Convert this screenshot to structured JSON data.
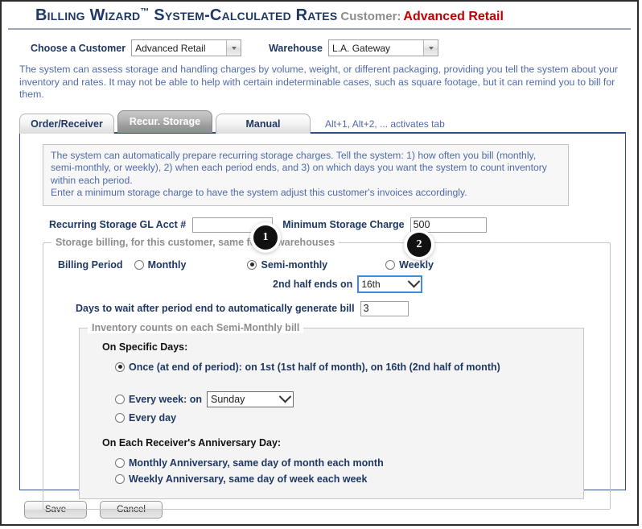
{
  "header": {
    "title_main": "Billing Wizard",
    "title_tm": "™",
    "title_rest": " System-Calculated Rates",
    "customer_label": "Customer:",
    "customer_value": "Advanced Retail"
  },
  "selectors": {
    "customer_label": "Choose a Customer",
    "customer_value": "Advanced Retail",
    "warehouse_label": "Warehouse",
    "warehouse_value": "L.A. Gateway"
  },
  "intro": "The system can assess storage and handling charges by volume, weight, or different packaging, providing you tell the system about your inventory and rates. It may not be able to help with certain indeterminable cases, such as square footage, but it can remind you to bill for them.",
  "tabs": [
    {
      "label": "Order/Receiver",
      "active": false
    },
    {
      "label": "Recur. Storage",
      "active": true
    },
    {
      "label": "Manual",
      "active": false
    }
  ],
  "tab_hint": "Alt+1, Alt+2, ... activates tab",
  "infobox": {
    "line1": "The system can automatically prepare recurring storage charges. Tell the system: 1) how often you bill (monthly, semi-monthly, or weekly), 2) when each period ends, and 3) on which days you want the system to count inventory within each period.",
    "line2": "Enter a minimum storage charge to have the system adjust this customer's invoices accordingly."
  },
  "gl_row": {
    "gl_label": "Recurring Storage GL Acct #",
    "gl_value": "",
    "min_label": "Minimum Storage Charge",
    "min_value": "500"
  },
  "storage_fieldset": {
    "legend": "Storage billing, for this customer, same for all warehouses",
    "billing_period_label": "Billing Period",
    "options": [
      {
        "label": "Monthly",
        "checked": false
      },
      {
        "label": "Semi-monthly",
        "checked": true
      },
      {
        "label": "Weekly",
        "checked": false
      }
    ],
    "second_half_label": "2nd half ends on",
    "second_half_value": "16th",
    "days_label": "Days to wait after period end to automatically generate bill",
    "days_value": "3"
  },
  "inventory_fieldset": {
    "legend": "Inventory counts on each Semi-Monthly bill",
    "specific_days_head": "On Specific Days:",
    "once_option": {
      "label": "Once (at end of period): on 1st (1st half of month), on 16th (2nd half of month)",
      "checked": true
    },
    "every_week": {
      "label": "Every week: on",
      "value": "Sunday",
      "checked": false
    },
    "every_day": {
      "label": "Every day",
      "checked": false
    },
    "anniversary_head": "On Each Receiver's Anniversary Day:",
    "monthly_anniversary": {
      "label": "Monthly Anniversary, same day of month each month",
      "checked": false
    },
    "weekly_anniversary": {
      "label": "Weekly Anniversary, same day of week each week",
      "checked": false
    }
  },
  "footer": {
    "save_label": "Save",
    "cancel_label": "Cancel"
  },
  "callouts": [
    {
      "number": "1"
    },
    {
      "number": "2"
    }
  ],
  "colors": {
    "title_navy": "#1f3864",
    "customer_red": "#c00000",
    "body_blue": "#4f6aa8",
    "legend_gray": "#8d8d8d",
    "tab_border": "#2f4f86"
  }
}
